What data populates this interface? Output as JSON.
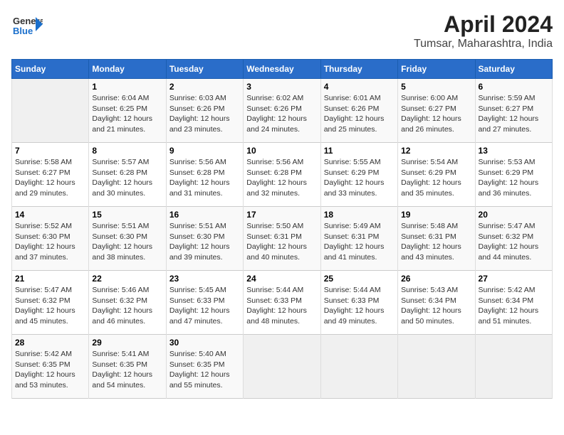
{
  "header": {
    "logo_general": "General",
    "logo_blue": "Blue",
    "title": "April 2024",
    "subtitle": "Tumsar, Maharashtra, India"
  },
  "calendar": {
    "days_of_week": [
      "Sunday",
      "Monday",
      "Tuesday",
      "Wednesday",
      "Thursday",
      "Friday",
      "Saturday"
    ],
    "weeks": [
      [
        {
          "day": "",
          "content": ""
        },
        {
          "day": "1",
          "content": "Sunrise: 6:04 AM\nSunset: 6:25 PM\nDaylight: 12 hours\nand 21 minutes."
        },
        {
          "day": "2",
          "content": "Sunrise: 6:03 AM\nSunset: 6:26 PM\nDaylight: 12 hours\nand 23 minutes."
        },
        {
          "day": "3",
          "content": "Sunrise: 6:02 AM\nSunset: 6:26 PM\nDaylight: 12 hours\nand 24 minutes."
        },
        {
          "day": "4",
          "content": "Sunrise: 6:01 AM\nSunset: 6:26 PM\nDaylight: 12 hours\nand 25 minutes."
        },
        {
          "day": "5",
          "content": "Sunrise: 6:00 AM\nSunset: 6:27 PM\nDaylight: 12 hours\nand 26 minutes."
        },
        {
          "day": "6",
          "content": "Sunrise: 5:59 AM\nSunset: 6:27 PM\nDaylight: 12 hours\nand 27 minutes."
        }
      ],
      [
        {
          "day": "7",
          "content": "Sunrise: 5:58 AM\nSunset: 6:27 PM\nDaylight: 12 hours\nand 29 minutes."
        },
        {
          "day": "8",
          "content": "Sunrise: 5:57 AM\nSunset: 6:28 PM\nDaylight: 12 hours\nand 30 minutes."
        },
        {
          "day": "9",
          "content": "Sunrise: 5:56 AM\nSunset: 6:28 PM\nDaylight: 12 hours\nand 31 minutes."
        },
        {
          "day": "10",
          "content": "Sunrise: 5:56 AM\nSunset: 6:28 PM\nDaylight: 12 hours\nand 32 minutes."
        },
        {
          "day": "11",
          "content": "Sunrise: 5:55 AM\nSunset: 6:29 PM\nDaylight: 12 hours\nand 33 minutes."
        },
        {
          "day": "12",
          "content": "Sunrise: 5:54 AM\nSunset: 6:29 PM\nDaylight: 12 hours\nand 35 minutes."
        },
        {
          "day": "13",
          "content": "Sunrise: 5:53 AM\nSunset: 6:29 PM\nDaylight: 12 hours\nand 36 minutes."
        }
      ],
      [
        {
          "day": "14",
          "content": "Sunrise: 5:52 AM\nSunset: 6:30 PM\nDaylight: 12 hours\nand 37 minutes."
        },
        {
          "day": "15",
          "content": "Sunrise: 5:51 AM\nSunset: 6:30 PM\nDaylight: 12 hours\nand 38 minutes."
        },
        {
          "day": "16",
          "content": "Sunrise: 5:51 AM\nSunset: 6:30 PM\nDaylight: 12 hours\nand 39 minutes."
        },
        {
          "day": "17",
          "content": "Sunrise: 5:50 AM\nSunset: 6:31 PM\nDaylight: 12 hours\nand 40 minutes."
        },
        {
          "day": "18",
          "content": "Sunrise: 5:49 AM\nSunset: 6:31 PM\nDaylight: 12 hours\nand 41 minutes."
        },
        {
          "day": "19",
          "content": "Sunrise: 5:48 AM\nSunset: 6:31 PM\nDaylight: 12 hours\nand 43 minutes."
        },
        {
          "day": "20",
          "content": "Sunrise: 5:47 AM\nSunset: 6:32 PM\nDaylight: 12 hours\nand 44 minutes."
        }
      ],
      [
        {
          "day": "21",
          "content": "Sunrise: 5:47 AM\nSunset: 6:32 PM\nDaylight: 12 hours\nand 45 minutes."
        },
        {
          "day": "22",
          "content": "Sunrise: 5:46 AM\nSunset: 6:32 PM\nDaylight: 12 hours\nand 46 minutes."
        },
        {
          "day": "23",
          "content": "Sunrise: 5:45 AM\nSunset: 6:33 PM\nDaylight: 12 hours\nand 47 minutes."
        },
        {
          "day": "24",
          "content": "Sunrise: 5:44 AM\nSunset: 6:33 PM\nDaylight: 12 hours\nand 48 minutes."
        },
        {
          "day": "25",
          "content": "Sunrise: 5:44 AM\nSunset: 6:33 PM\nDaylight: 12 hours\nand 49 minutes."
        },
        {
          "day": "26",
          "content": "Sunrise: 5:43 AM\nSunset: 6:34 PM\nDaylight: 12 hours\nand 50 minutes."
        },
        {
          "day": "27",
          "content": "Sunrise: 5:42 AM\nSunset: 6:34 PM\nDaylight: 12 hours\nand 51 minutes."
        }
      ],
      [
        {
          "day": "28",
          "content": "Sunrise: 5:42 AM\nSunset: 6:35 PM\nDaylight: 12 hours\nand 53 minutes."
        },
        {
          "day": "29",
          "content": "Sunrise: 5:41 AM\nSunset: 6:35 PM\nDaylight: 12 hours\nand 54 minutes."
        },
        {
          "day": "30",
          "content": "Sunrise: 5:40 AM\nSunset: 6:35 PM\nDaylight: 12 hours\nand 55 minutes."
        },
        {
          "day": "",
          "content": ""
        },
        {
          "day": "",
          "content": ""
        },
        {
          "day": "",
          "content": ""
        },
        {
          "day": "",
          "content": ""
        }
      ]
    ]
  }
}
